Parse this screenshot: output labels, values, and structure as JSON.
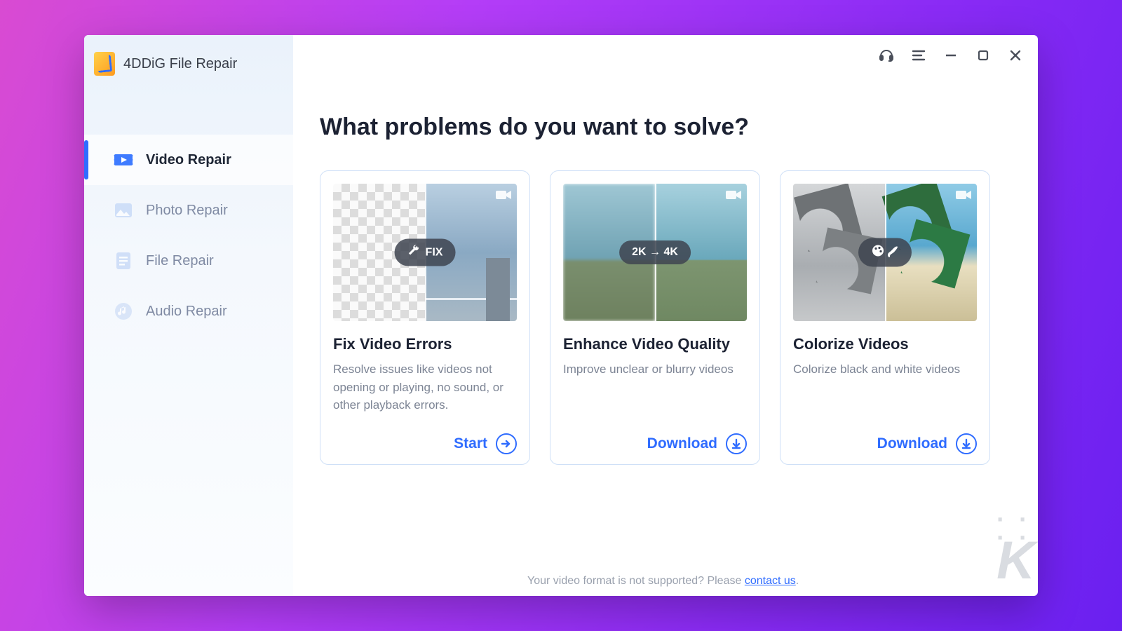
{
  "app": {
    "name": "4DDiG File Repair"
  },
  "sidebar": {
    "items": [
      {
        "label": "Video Repair",
        "icon": "video-icon",
        "active": true
      },
      {
        "label": "Photo Repair",
        "icon": "photo-icon",
        "active": false
      },
      {
        "label": "File Repair",
        "icon": "file-icon",
        "active": false
      },
      {
        "label": "Audio Repair",
        "icon": "audio-icon",
        "active": false
      }
    ]
  },
  "main": {
    "heading": "What problems do you want to solve?",
    "cards": [
      {
        "badge_icon": "wrench-icon",
        "badge_text": "FIX",
        "title": "Fix Video Errors",
        "desc": "Resolve issues like videos not opening or playing, no sound, or other playback errors.",
        "action_label": "Start",
        "action_icon": "arrow-right-icon"
      },
      {
        "badge_text": "2K → 4K",
        "title": "Enhance Video Quality",
        "desc": "Improve unclear or blurry videos",
        "action_label": "Download",
        "action_icon": "download-icon"
      },
      {
        "badge_icon": "palette-brush-icon",
        "title": "Colorize Videos",
        "desc": "Colorize black and white videos",
        "action_label": "Download",
        "action_icon": "download-icon"
      }
    ],
    "footer_prefix": "Your video format is not supported? Please ",
    "footer_link": "contact us",
    "footer_suffix": "."
  },
  "titlebar": {
    "support_icon": "headset-icon",
    "menu_icon": "menu-icon",
    "minimize_icon": "minimize-icon",
    "maximize_icon": "maximize-icon",
    "close_icon": "close-icon"
  },
  "watermark": "K"
}
